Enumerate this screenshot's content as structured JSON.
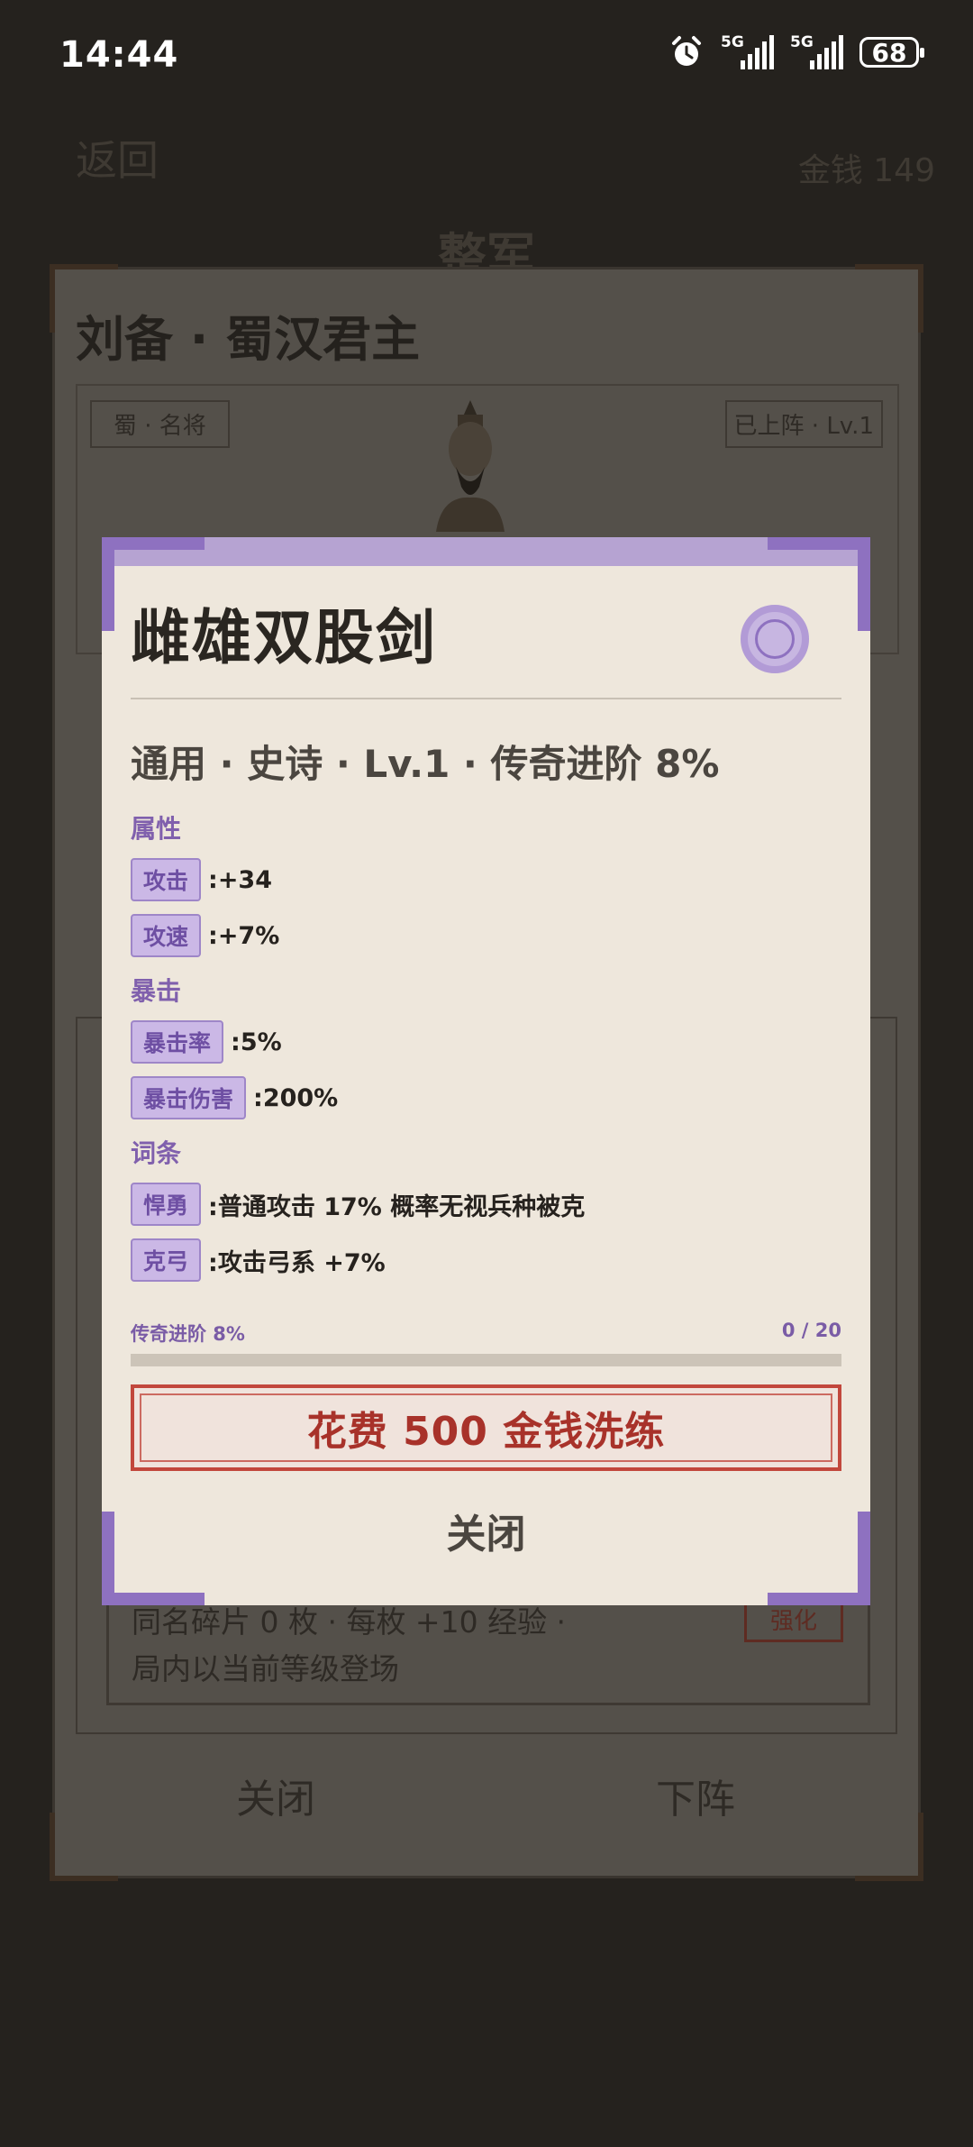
{
  "status_bar": {
    "time": "14:44",
    "net1": "5G",
    "net2": "5G",
    "battery": "68"
  },
  "background": {
    "back_label": "返回",
    "gold_label": "金钱 149",
    "page_title": "整军",
    "hero_name": "刘备 · 蜀汉君主",
    "faction_badge": "蜀 · 名将",
    "status_badge": "已上阵 · Lv.1",
    "fragment_line1": "同名碎片 0 枚 · 每枚 +10 经验 ·",
    "fragment_line2": "局内以当前等级登场",
    "upgrade_label": "强化",
    "close_label": "关闭",
    "unassign_label": "下阵"
  },
  "modal": {
    "title": "雌雄双股剑",
    "subtitle": "通用 · 史诗 · Lv.1 · 传奇进阶 8%",
    "sections": {
      "attributes": "属性",
      "crit": "暴击",
      "affixes": "词条"
    },
    "attributes": [
      {
        "name": "攻击",
        "value": ":+34"
      },
      {
        "name": "攻速",
        "value": ":+7%"
      }
    ],
    "crit": [
      {
        "name": "暴击率",
        "value": ":5%"
      },
      {
        "name": "暴击伤害",
        "value": ":200%"
      }
    ],
    "affixes": [
      {
        "name": "悍勇",
        "value": ":普通攻击 17% 概率无视兵种被克"
      },
      {
        "name": "克弓",
        "value": ":攻击弓系 +7%"
      }
    ],
    "progress": {
      "label": "传奇进阶 8%",
      "count": "0 / 20",
      "fraction": 0
    },
    "reforge_label": "花费 500 金钱洗练",
    "close_label": "关闭"
  },
  "colors": {
    "accent": "#8e71c0",
    "danger": "#c2473c",
    "paper": "#eee7dc"
  }
}
